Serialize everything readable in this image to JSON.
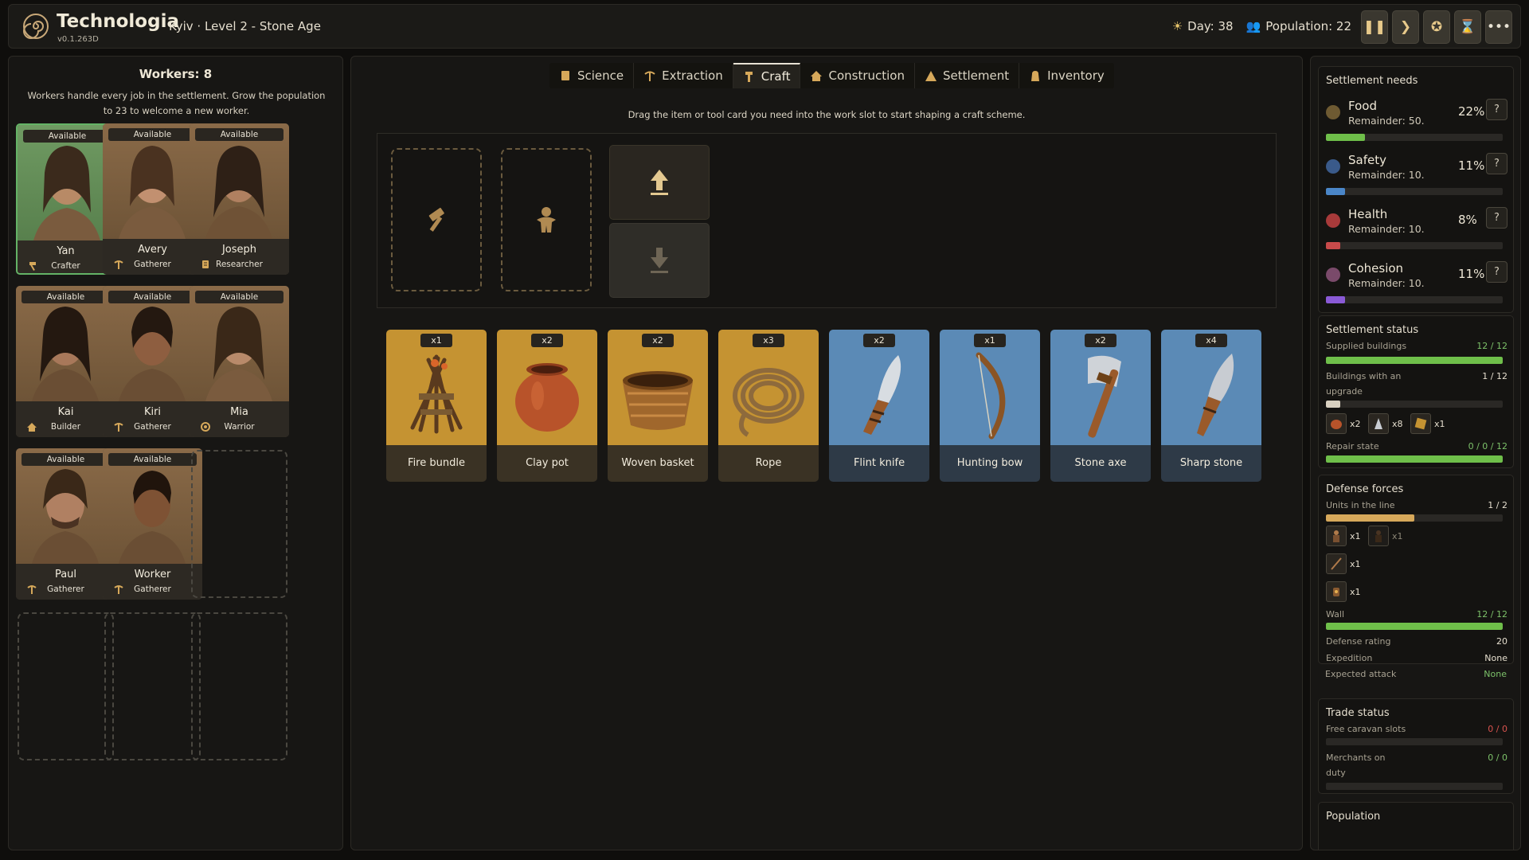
{
  "header": {
    "app_title": "Technologia",
    "version": "v0.1.263D",
    "location": "Kyiv · Level 2 - Stone Age",
    "day": "Day: 38",
    "population": "Population: 22",
    "buttons": [
      "pause",
      "next",
      "achievements",
      "time",
      "more"
    ]
  },
  "workers": {
    "title": "Workers: 8",
    "description": "Workers handle every job in the settlement. Grow the population to 23 to welcome a new worker.",
    "list": [
      {
        "status": "Available",
        "name": "Yan",
        "role": "Crafter",
        "role_icon": "hammer-icon",
        "selected": true
      },
      {
        "status": "Available",
        "name": "Avery",
        "role": "Gatherer",
        "role_icon": "pickaxe-icon"
      },
      {
        "status": "Available",
        "name": "Joseph",
        "role": "Researcher",
        "role_icon": "scroll-icon"
      },
      {
        "status": "Available",
        "name": "Kai",
        "role": "Builder",
        "role_icon": "hut-icon"
      },
      {
        "status": "Available",
        "name": "Kiri",
        "role": "Gatherer",
        "role_icon": "pickaxe-icon"
      },
      {
        "status": "Available",
        "name": "Mia",
        "role": "Warrior",
        "role_icon": "shield-icon"
      },
      {
        "status": "Available",
        "name": "Paul",
        "role": "Gatherer",
        "role_icon": "pickaxe-icon"
      },
      {
        "status": "Available",
        "name": "Worker",
        "role": "Gatherer",
        "role_icon": "pickaxe-icon"
      }
    ]
  },
  "tabs": [
    {
      "label": "Science",
      "icon": "scroll-icon"
    },
    {
      "label": "Extraction",
      "icon": "pickaxe-icon"
    },
    {
      "label": "Craft",
      "icon": "hammer-icon",
      "active": true
    },
    {
      "label": "Construction",
      "icon": "hut-icon"
    },
    {
      "label": "Settlement",
      "icon": "tent-icon"
    },
    {
      "label": "Inventory",
      "icon": "bag-icon"
    }
  ],
  "craft": {
    "hint": "Drag the item or tool card you need into the work slot to start shaping a craft scheme.",
    "items": [
      {
        "name": "Fire bundle",
        "qty": "x1",
        "kind": "brown",
        "icon": "fire-bundle-icon"
      },
      {
        "name": "Clay pot",
        "qty": "x2",
        "kind": "brown",
        "icon": "clay-pot-icon"
      },
      {
        "name": "Woven basket",
        "qty": "x2",
        "kind": "brown",
        "icon": "basket-icon"
      },
      {
        "name": "Rope",
        "qty": "x3",
        "kind": "brown",
        "icon": "rope-icon"
      },
      {
        "name": "Flint knife",
        "qty": "x2",
        "kind": "blue",
        "icon": "knife-icon"
      },
      {
        "name": "Hunting bow",
        "qty": "x1",
        "kind": "blue",
        "icon": "bow-icon"
      },
      {
        "name": "Stone axe",
        "qty": "x2",
        "kind": "blue",
        "icon": "axe-icon"
      },
      {
        "name": "Sharp stone",
        "qty": "x4",
        "kind": "blue",
        "icon": "sharp-stone-icon"
      }
    ]
  },
  "needs": {
    "title": "Settlement needs",
    "list": [
      {
        "name": "Food",
        "remainder": "Remainder: 50.",
        "percent": "22%",
        "value": 0.22,
        "color": "#6fbf4a"
      },
      {
        "name": "Safety",
        "remainder": "Remainder: 10.",
        "percent": "11%",
        "value": 0.11,
        "color": "#4a86c8"
      },
      {
        "name": "Health",
        "remainder": "Remainder: 10.",
        "percent": "8%",
        "value": 0.08,
        "color": "#c84a4a"
      },
      {
        "name": "Cohesion",
        "remainder": "Remainder: 10.",
        "percent": "11%",
        "value": 0.11,
        "color": "#8a5ad6"
      }
    ],
    "help": "?"
  },
  "status": {
    "title": "Settlement status",
    "supplied_label": "Supplied buildings",
    "supplied_value": "12 / 12",
    "supplied_fill": 1.0,
    "upgrade_label": "Buildings with an upgrade",
    "upgrade_value": "1 / 12",
    "upgrade_fill": 0.08,
    "resources": [
      {
        "icon": "clay-pot-icon",
        "qty": "x2"
      },
      {
        "icon": "stone-icon",
        "qty": "x8"
      },
      {
        "icon": "plank-icon",
        "qty": "x1"
      }
    ],
    "repair_label": "Repair state",
    "repair_value": "0 / 0 / 12",
    "repair_fill": 1.0
  },
  "defense": {
    "title": "Defense forces",
    "units_label": "Units in the line",
    "units_value": "1 / 2",
    "units_fill": 0.5,
    "units": [
      {
        "icon": "warrior-icon",
        "qty": "x1"
      },
      {
        "icon": "warrior-shadow-icon",
        "qty": "x1",
        "dim": true
      },
      {
        "icon": "spear-icon",
        "qty": "x1"
      },
      {
        "icon": "lantern-icon",
        "qty": "x1"
      }
    ],
    "wall_label": "Wall",
    "wall_value": "12 / 12",
    "wall_fill": 1.0,
    "rating_label": "Defense rating",
    "rating_value": "20",
    "expedition_label": "Expedition",
    "expedition_value": "None",
    "attack_label": "Expected attack",
    "attack_value": "None"
  },
  "trade": {
    "title": "Trade status",
    "caravan_label": "Free caravan slots",
    "caravan_value": "0 / 0",
    "merchants_label": "Merchants on duty",
    "merchants_value": "0 / 0"
  },
  "population_box": {
    "title": "Population"
  },
  "colors": {
    "accent_gold": "#c59332",
    "accent_blue": "#5b8ab6",
    "green": "#7dc26a",
    "bar_green": "#6fbf4a",
    "bar_tan": "#d6a85a",
    "red": "#d9534f"
  }
}
